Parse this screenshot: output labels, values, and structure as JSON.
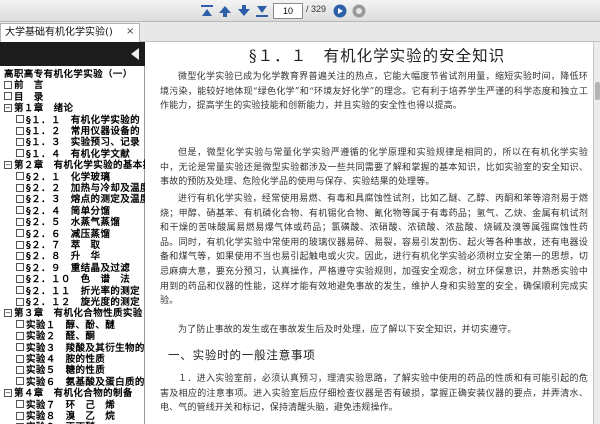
{
  "toolbar": {
    "page_current": "10",
    "page_total": "/ 329",
    "icons": [
      "first-page-icon",
      "previous-page-icon",
      "next-page-icon",
      "last-page-icon",
      "go-icon",
      "options-icon"
    ]
  },
  "tab": {
    "title": "大学基础有机化学实验()",
    "close": "×"
  },
  "sidebar": {
    "items": [
      {
        "ctrl": "",
        "label": "高职高专有机化学实验（一）"
      },
      {
        "ctrl": "□",
        "label": "前　言"
      },
      {
        "ctrl": "□",
        "label": "目　录"
      },
      {
        "ctrl": "-",
        "label": "第１章　绪论"
      },
      {
        "ctrl": "□",
        "label": "§１．１　有机化学实验的"
      },
      {
        "ctrl": "□",
        "label": "§１．２　常用仪器设备的"
      },
      {
        "ctrl": "□",
        "label": "§１．３　实验预习、记录"
      },
      {
        "ctrl": "□",
        "label": "§１．４　有机化学文献"
      },
      {
        "ctrl": "-",
        "label": "第２章　有机化学实验的基本操"
      },
      {
        "ctrl": "□",
        "label": "§２．１　化学玻璃"
      },
      {
        "ctrl": "□",
        "label": "§２．２　加热与冷却及温度"
      },
      {
        "ctrl": "□",
        "label": "§２．３　熔点的测定及温度"
      },
      {
        "ctrl": "□",
        "label": "§２．４　简单分馏"
      },
      {
        "ctrl": "□",
        "label": "§２．５　水蒸气蒸馏"
      },
      {
        "ctrl": "□",
        "label": "§２．６　减压蒸馏"
      },
      {
        "ctrl": "□",
        "label": "§２．７　萃　取"
      },
      {
        "ctrl": "□",
        "label": "§２．８　升　华"
      },
      {
        "ctrl": "□",
        "label": "§２．９　重结晶及过滤"
      },
      {
        "ctrl": "□",
        "label": "§２．１０　色　谱　法"
      },
      {
        "ctrl": "□",
        "label": "§２．１１　折光率的测定"
      },
      {
        "ctrl": "□",
        "label": "§２．１２　旋光度的测定"
      },
      {
        "ctrl": "-",
        "label": "第３章　有机化合物性质实验"
      },
      {
        "ctrl": "□",
        "label": "实验１　醇、酚、醚"
      },
      {
        "ctrl": "□",
        "label": "实验２　醛、酮"
      },
      {
        "ctrl": "□",
        "label": "实验３　羧酸及其衍生物的"
      },
      {
        "ctrl": "□",
        "label": "实验４　胺的性质"
      },
      {
        "ctrl": "□",
        "label": "实验５　糖的性质"
      },
      {
        "ctrl": "□",
        "label": "实验６　氨基酸及蛋白质的"
      },
      {
        "ctrl": "-",
        "label": "第４章　有机化合物的制备"
      },
      {
        "ctrl": "□",
        "label": "实验７　环　己　烯"
      },
      {
        "ctrl": "□",
        "label": "实验８　溴　乙　烷"
      },
      {
        "ctrl": "□",
        "label": "实验９　正丁醚"
      },
      {
        "ctrl": "□",
        "label": "实验１０　正　溴　丁　烷"
      }
    ]
  },
  "content": {
    "title": "§１．１　有机化学实验的安全知识",
    "paragraphs": [
      "微型化学实验已成为化学教育界普遍关注的热点，它能大幅度节省试剂用量，缩短实验时间，降低环境污染，能较好地体现“绿色化学”和“环境友好化学”的理念。它有利于培养学生严谨的科学态度和独立工作能力，提高学生的实验技能和创新能力，并且实验的安全性也得以提高。",
      "但是，微型化学实验与常量化学实验严遵循的化学原理和实验规律是相同的，所以在有机化学实验中，无论是常量实验还是微型实验都涉及一些共同需要了解和掌握的基本知识，比如实验室的安全知识、事故的预防及处理、危险化学品的使用与保存、实验结果的处理等。",
      "进行有机化学实验，经常使用易燃、有毒和具腐蚀性试剂，比如乙醚、乙醇、丙酮和苯等溶剂易于燃烧；甲醇、硝基苯、有机磷化合物、有机锡化合物、氰化物等属于有毒药品；氢气、乙炔、金属有机试剂和干燥的苦味酸属易燃易爆气体或药品；氯磺酸、浓硝酸、浓硫酸、浓盐酸、烧碱及溴等属强腐蚀性药品。同时，有机化学实验中常使用的玻璃仪器易碎、易裂，容易引发割伤、起火等各种事故，还有电器设备和煤气等，如果使用不当也易引起触电或火灾。因此，进行有机化学实验必须树立安全第一的思想，切忌麻痹大意，要充分预习，认真操作，严格遵守实验规则，加强安全观念，树立环保意识，并熟悉实验中用到的药品和仪器的性能，这样才能有效地避免事故的发生，维护人身和实验室的安全，确保顺利完成实验。",
      "为了防止事故的发生或在事故发生后及时处理，应了解以下安全知识，并切实遵守。"
    ],
    "section_heading": "一、实验时的一般注意事项",
    "last_paragraph": "１．进入实验室前，必须认真预习，理清实验思路，了解实验中使用的药品的性质和有可能引起的危害及相应的注意事项。进入实验室后应仔细检查仪器是否有破损，掌握正确安装仪器的要点，并弄清水、电、气的管线开关和标记，保持清醒头脑，避免违规操作。"
  },
  "colors": {
    "toolbar_icon_blue": "#2e5fa8",
    "sidebar_header": "#1c1c1c",
    "text": "#333333"
  }
}
